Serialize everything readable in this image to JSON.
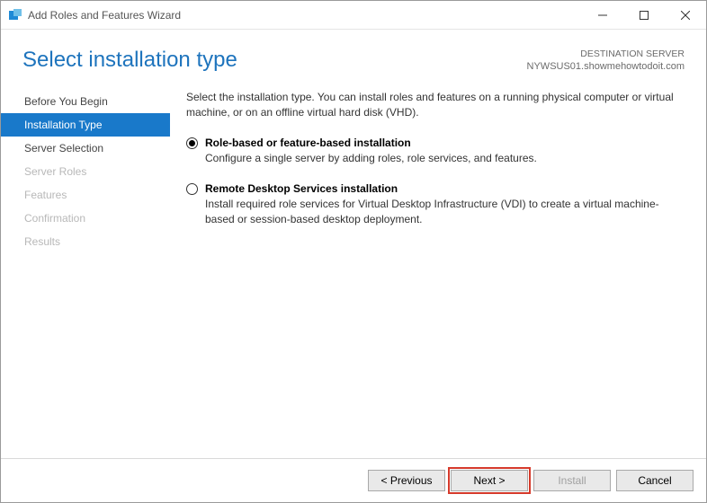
{
  "window": {
    "title": "Add Roles and Features Wizard"
  },
  "header": {
    "page_title": "Select installation type",
    "dest_label": "DESTINATION SERVER",
    "dest_server": "NYWSUS01.showmehowtodoit.com"
  },
  "steps": [
    {
      "label": "Before You Begin",
      "state": "normal"
    },
    {
      "label": "Installation Type",
      "state": "active"
    },
    {
      "label": "Server Selection",
      "state": "normal"
    },
    {
      "label": "Server Roles",
      "state": "disabled"
    },
    {
      "label": "Features",
      "state": "disabled"
    },
    {
      "label": "Confirmation",
      "state": "disabled"
    },
    {
      "label": "Results",
      "state": "disabled"
    }
  ],
  "content": {
    "intro": "Select the installation type. You can install roles and features on a running physical computer or virtual machine, or on an offline virtual hard disk (VHD).",
    "options": [
      {
        "title": "Role-based or feature-based installation",
        "desc": "Configure a single server by adding roles, role services, and features.",
        "checked": true
      },
      {
        "title": "Remote Desktop Services installation",
        "desc": "Install required role services for Virtual Desktop Infrastructure (VDI) to create a virtual machine-based or session-based desktop deployment.",
        "checked": false
      }
    ]
  },
  "footer": {
    "previous": "< Previous",
    "next": "Next >",
    "install": "Install",
    "cancel": "Cancel"
  }
}
